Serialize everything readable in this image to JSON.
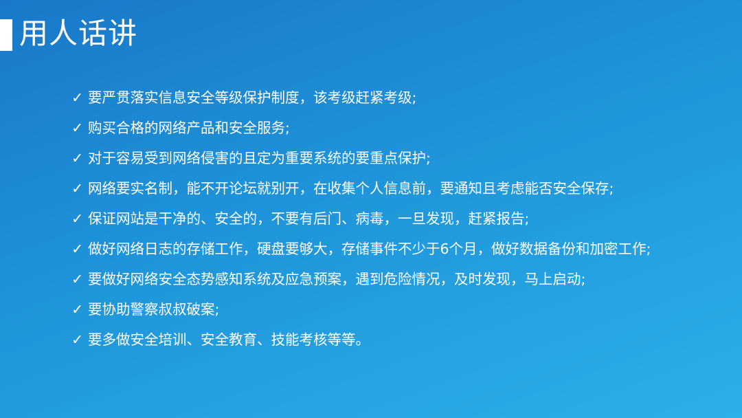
{
  "slide": {
    "title": "用人话讲",
    "check_glyph": "✓",
    "bullets": [
      "要严贯落实信息安全等级保护制度，该考级赶紧考级;",
      "购买合格的网络产品和安全服务;",
      "对于容易受到网络侵害的且定为重要系统的要重点保护;",
      "网络要实名制，能不开论坛就别开，在收集个人信息前，要通知且考虑能否安全保存;",
      "保证网站是干净的、安全的，不要有后门、病毒，一旦发现，赶紧报告;",
      "做好网络日志的存储工作，硬盘要够大，存储事件不少于6个月，做好数据备份和加密工作;",
      "要做好网络安全态势感知系统及应急预案，遇到危险情况，及时发现，马上启动;",
      "要协助警察叔叔破案;",
      "要多做安全培训、安全教育、技能考核等等。"
    ]
  }
}
